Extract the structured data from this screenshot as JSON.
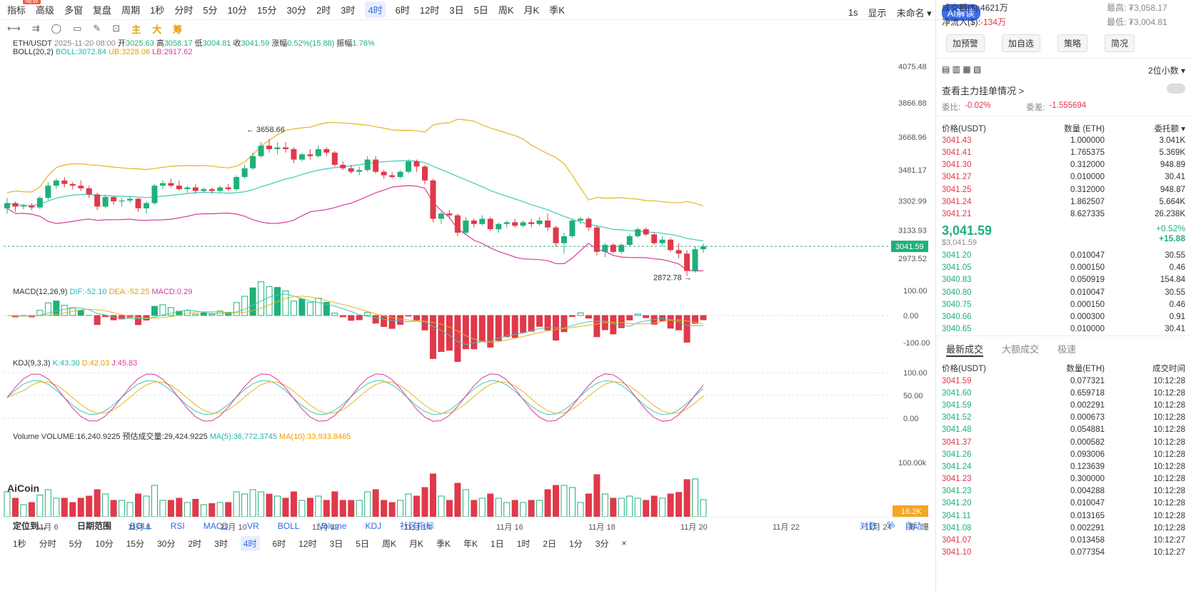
{
  "toolbar": {
    "items": [
      "指标",
      "高级",
      "多窗",
      "复盘",
      "",
      "周期",
      "1秒",
      "分时",
      "5分",
      "10分",
      "15分",
      "30分",
      "2时",
      "3时",
      "4时",
      "6时",
      "12时",
      "3日",
      "5日",
      "周K",
      "月K",
      "季K"
    ],
    "active": "4时",
    "new_badge": "NEW",
    "right": {
      "1s": "1s",
      "display": "显示",
      "account": "未命名",
      "ai": "AI解读"
    }
  },
  "drawbar": {
    "labels": [
      "主",
      "大",
      "筹"
    ]
  },
  "info": {
    "pair": "ETH/USDT",
    "time": "2025-11-20 08:00",
    "open_lbl": "开",
    "open": "3025.63",
    "high_lbl": "高",
    "high": "3058.17",
    "low_lbl": "低",
    "low": "3004.81",
    "close_lbl": "收",
    "close": "3041.59",
    "chg_lbl": "涨幅",
    "chg": "0.52%(15.88)",
    "amp_lbl": "振幅",
    "amp": "1.76%",
    "boll_name": "BOLL(20,2)",
    "boll": "BOLL:3072.84",
    "ub": "UB:3228.06",
    "lb": "LB:2917.62",
    "macd_name": "MACD(12,26,9)",
    "dif": "DIF:-52.10",
    "dea": "DEA:-52.25",
    "macd": "MACD:0.29",
    "kdj_name": "KDJ(9,3,3)",
    "k": "K:43.30",
    "d": "D:42.03",
    "j": "J:45.83",
    "vol_name": "Volume",
    "vol": "VOLUME:16,240.9225",
    "est": "预估成交量:29,424.9225",
    "ma5": "MA(5):36,772.3745",
    "ma10": "MA(10):33,933.8465"
  },
  "axes": {
    "price_ticks": [
      "4075.48",
      "3866.88",
      "3668.96",
      "3481.17",
      "3302.99",
      "3133.93",
      "2973.52"
    ],
    "price_now": "3041.59",
    "macd_ticks": [
      "100.00",
      "0.00",
      "-100.00"
    ],
    "kdj_ticks": [
      "100.00",
      "50.00",
      "0.00"
    ],
    "vol_tick": "100.00k",
    "vol_now": "16.2K",
    "x_ticks": [
      "11月 6",
      "11月 8",
      "11月 10",
      "11月 12",
      "11月 14",
      "11月 16",
      "11月 18",
      "11月 20",
      "11月 22",
      "11月 24"
    ],
    "x_right": [
      "筹",
      "爆"
    ],
    "max_label": "3658.66",
    "min_label": "2872.78",
    "logo": "AiCoin"
  },
  "chart_data": {
    "type": "candlestick",
    "ylim": [
      2870,
      4100
    ],
    "candles": [
      [
        3260,
        3320,
        3230,
        3290
      ],
      [
        3290,
        3300,
        3240,
        3270
      ],
      [
        3270,
        3285,
        3255,
        3275
      ],
      [
        3275,
        3290,
        3250,
        3265
      ],
      [
        3265,
        3330,
        3255,
        3320
      ],
      [
        3320,
        3410,
        3310,
        3390
      ],
      [
        3390,
        3430,
        3370,
        3420
      ],
      [
        3420,
        3440,
        3380,
        3400
      ],
      [
        3400,
        3410,
        3370,
        3390
      ],
      [
        3390,
        3420,
        3360,
        3375
      ],
      [
        3375,
        3390,
        3320,
        3340
      ],
      [
        3340,
        3350,
        3250,
        3270
      ],
      [
        3270,
        3340,
        3260,
        3325
      ],
      [
        3325,
        3330,
        3280,
        3300
      ],
      [
        3300,
        3320,
        3270,
        3305
      ],
      [
        3305,
        3330,
        3290,
        3315
      ],
      [
        3315,
        3320,
        3240,
        3260
      ],
      [
        3260,
        3300,
        3230,
        3290
      ],
      [
        3290,
        3400,
        3280,
        3390
      ],
      [
        3390,
        3420,
        3370,
        3405
      ],
      [
        3405,
        3430,
        3380,
        3390
      ],
      [
        3390,
        3420,
        3360,
        3370
      ],
      [
        3370,
        3390,
        3350,
        3380
      ],
      [
        3380,
        3400,
        3345,
        3360
      ],
      [
        3360,
        3380,
        3350,
        3370
      ],
      [
        3370,
        3380,
        3345,
        3360
      ],
      [
        3360,
        3390,
        3350,
        3380
      ],
      [
        3380,
        3400,
        3360,
        3370
      ],
      [
        3370,
        3450,
        3360,
        3440
      ],
      [
        3440,
        3510,
        3430,
        3490
      ],
      [
        3490,
        3580,
        3480,
        3560
      ],
      [
        3560,
        3640,
        3550,
        3620
      ],
      [
        3620,
        3659,
        3580,
        3600
      ],
      [
        3600,
        3640,
        3570,
        3610
      ],
      [
        3610,
        3640,
        3580,
        3600
      ],
      [
        3600,
        3610,
        3520,
        3540
      ],
      [
        3540,
        3580,
        3530,
        3570
      ],
      [
        3570,
        3600,
        3540,
        3560
      ],
      [
        3560,
        3620,
        3550,
        3600
      ],
      [
        3600,
        3610,
        3560,
        3580
      ],
      [
        3580,
        3590,
        3500,
        3510
      ],
      [
        3510,
        3530,
        3480,
        3490
      ],
      [
        3490,
        3510,
        3460,
        3470
      ],
      [
        3470,
        3500,
        3450,
        3480
      ],
      [
        3480,
        3560,
        3470,
        3540
      ],
      [
        3540,
        3560,
        3460,
        3470
      ],
      [
        3470,
        3480,
        3430,
        3450
      ],
      [
        3450,
        3470,
        3430,
        3440
      ],
      [
        3440,
        3480,
        3430,
        3470
      ],
      [
        3470,
        3540,
        3460,
        3530
      ],
      [
        3530,
        3540,
        3470,
        3500
      ],
      [
        3500,
        3510,
        3400,
        3420
      ],
      [
        3420,
        3430,
        3180,
        3200
      ],
      [
        3200,
        3240,
        3170,
        3230
      ],
      [
        3230,
        3250,
        3200,
        3220
      ],
      [
        3220,
        3230,
        3100,
        3120
      ],
      [
        3120,
        3210,
        3110,
        3190
      ],
      [
        3190,
        3200,
        3150,
        3170
      ],
      [
        3170,
        3220,
        3160,
        3200
      ],
      [
        3200,
        3210,
        3130,
        3140
      ],
      [
        3140,
        3180,
        3120,
        3170
      ],
      [
        3170,
        3190,
        3150,
        3180
      ],
      [
        3180,
        3200,
        3150,
        3160
      ],
      [
        3160,
        3190,
        3150,
        3180
      ],
      [
        3180,
        3200,
        3150,
        3170
      ],
      [
        3170,
        3210,
        3160,
        3190
      ],
      [
        3190,
        3230,
        3130,
        3150
      ],
      [
        3150,
        3160,
        3040,
        3060
      ],
      [
        3060,
        3120,
        3000,
        3100
      ],
      [
        3100,
        3200,
        3090,
        3190
      ],
      [
        3190,
        3210,
        3170,
        3200
      ],
      [
        3200,
        3210,
        3130,
        3150
      ],
      [
        3150,
        3160,
        2990,
        3010
      ],
      [
        3010,
        3060,
        2980,
        3050
      ],
      [
        3050,
        3060,
        3000,
        3010
      ],
      [
        3010,
        3060,
        3000,
        3050
      ],
      [
        3050,
        3110,
        3040,
        3100
      ],
      [
        3100,
        3150,
        3090,
        3140
      ],
      [
        3140,
        3150,
        3100,
        3110
      ],
      [
        3110,
        3120,
        3050,
        3060
      ],
      [
        3060,
        3100,
        3040,
        3080
      ],
      [
        3080,
        3090,
        3010,
        3020
      ],
      [
        3020,
        3060,
        2973,
        3000
      ],
      [
        3000,
        3020,
        2873,
        2900
      ],
      [
        2900,
        3040,
        2890,
        3025
      ],
      [
        3025,
        3058,
        3005,
        3042
      ]
    ]
  },
  "right": {
    "stats": [
      [
        "成交额($):",
        "4621万",
        "最高:",
        "₮3,058.17"
      ],
      [
        "净流入($):",
        "-134万",
        "最低:",
        "₮3,004.81"
      ]
    ],
    "buttons": [
      "加预警",
      "加自选",
      "策略",
      "简况"
    ],
    "decimals": "2位小数",
    "depth_title": "查看主力挂单情况 >",
    "ratio_lbl": "委比:",
    "ratio": "-0.02%",
    "diff_lbl": "委差:",
    "diff": "-1.555694",
    "ob_headers": [
      "价格(USDT)",
      "数量 (ETH)",
      "委托额"
    ],
    "asks": [
      [
        "3041.43",
        "1.000000",
        "3.041K"
      ],
      [
        "3041.41",
        "1.765375",
        "5.369K"
      ],
      [
        "3041.30",
        "0.312000",
        "948.89"
      ],
      [
        "3041.27",
        "0.010000",
        "30.41"
      ],
      [
        "3041.25",
        "0.312000",
        "948.87"
      ],
      [
        "3041.24",
        "1.862507",
        "5.664K"
      ],
      [
        "3041.21",
        "8.627335",
        "26.238K"
      ]
    ],
    "last": "3,041.59",
    "last_sub": "$3,041.59",
    "chg_pct": "+0.52%",
    "chg_abs": "+15.88",
    "bids": [
      [
        "3041.20",
        "0.010047",
        "30.55"
      ],
      [
        "3041.05",
        "0.000150",
        "0.46"
      ],
      [
        "3040.83",
        "0.050919",
        "154.84"
      ],
      [
        "3040.80",
        "0.010047",
        "30.55"
      ],
      [
        "3040.75",
        "0.000150",
        "0.46"
      ],
      [
        "3040.66",
        "0.000300",
        "0.91"
      ],
      [
        "3040.65",
        "0.010000",
        "30.41"
      ]
    ],
    "trade_tabs": [
      "最新成交",
      "大额成交",
      "极速"
    ],
    "trade_headers": [
      "价格(USDT)",
      "数量(ETH)",
      "成交时间"
    ],
    "trades": [
      [
        "3041.59",
        "0.077321",
        "10:12:28",
        "r"
      ],
      [
        "3041.60",
        "0.659718",
        "10:12:28",
        "g"
      ],
      [
        "3041.59",
        "0.002291",
        "10:12:28",
        "g"
      ],
      [
        "3041.52",
        "0.000673",
        "10:12:28",
        "g"
      ],
      [
        "3041.48",
        "0.054881",
        "10:12:28",
        "g"
      ],
      [
        "3041.37",
        "0.000582",
        "10:12:28",
        "r"
      ],
      [
        "3041.26",
        "0.093006",
        "10:12:28",
        "g"
      ],
      [
        "3041.24",
        "0.123639",
        "10:12:28",
        "g"
      ],
      [
        "3041.23",
        "0.300000",
        "10:12:28",
        "r"
      ],
      [
        "3041.23",
        "0.004288",
        "10:12:28",
        "g"
      ],
      [
        "3041.20",
        "0.010047",
        "10:12:28",
        "g"
      ],
      [
        "3041.11",
        "0.013165",
        "10:12:28",
        "g"
      ],
      [
        "3041.08",
        "0.002291",
        "10:12:28",
        "g"
      ],
      [
        "3041.07",
        "0.013458",
        "10:12:27",
        "r"
      ],
      [
        "3041.10",
        "0.077354",
        "10:12:27",
        "r"
      ]
    ]
  },
  "bottom": {
    "bar1": [
      "定位到...",
      "日期范围",
      "BOLL",
      "RSI",
      "MACD",
      "VR",
      "BOLL",
      "Volume",
      "KDJ",
      "社区指标"
    ],
    "bar1_right": [
      "对数",
      "%",
      "自动"
    ],
    "bar2": [
      "1秒",
      "分时",
      "5分",
      "10分",
      "15分",
      "30分",
      "2时",
      "3时",
      "4时",
      "6时",
      "12时",
      "3日",
      "5日",
      "周K",
      "月K",
      "季K",
      "年K",
      "1日",
      "1时",
      "2日",
      "1分",
      "3分",
      "×"
    ],
    "active": "4时"
  }
}
